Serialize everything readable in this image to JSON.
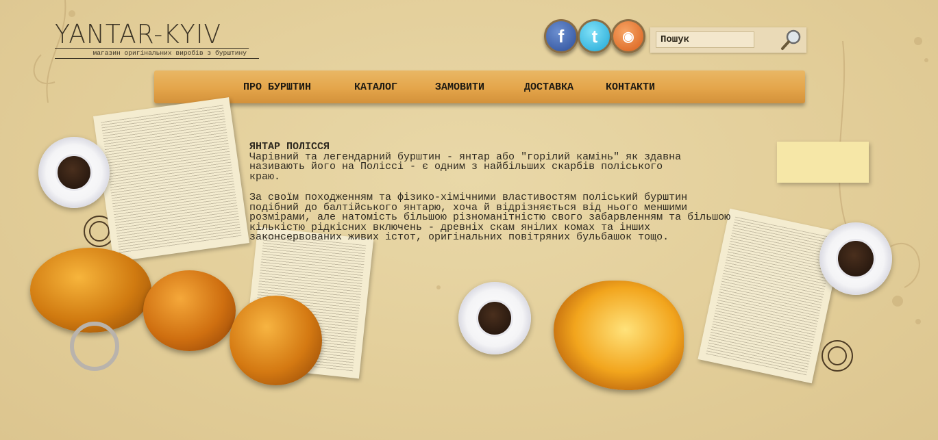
{
  "logo": {
    "title": "YANTAR-KYIV",
    "subtitle": "магазин оригінальних виробів з бурштину"
  },
  "social": [
    {
      "name": "facebook",
      "glyph": "f"
    },
    {
      "name": "twitter",
      "glyph": "t"
    },
    {
      "name": "rss",
      "glyph": "◉"
    }
  ],
  "search": {
    "value": "Пошук",
    "icon": "magnifier-icon"
  },
  "nav": {
    "items": [
      "ПРО БУРШТИН",
      "КАТАЛОГ",
      "ЗАМОВИТИ",
      "ДОСТАВКА",
      "КОНТАКТИ"
    ]
  },
  "article": {
    "title": "ЯНТАР ПОЛІССЯ",
    "paragraphs": [
      "Чарівний та легендарний бурштин - янтар або \"горілий камінь\" як здавна називають його на Поліссі - є одним з найбільших скарбів поліського краю.",
      "За своїм походженням та фізико-хімічними властивостям поліський бурштин подібний до балтійського янтарю, хоча й відрізняється від нього меншими розмірами, але натомість більшою різноманітністю свого забарвленням та більшою кількістю рідкісних включень - древніх скам янілих комах та інших законсервованих живих істот, оригінальних повітряних бульбашок тощо."
    ]
  },
  "colors": {
    "background": "#e3cf9c",
    "nav": "#e4a54a",
    "text": "#2f2a20"
  }
}
